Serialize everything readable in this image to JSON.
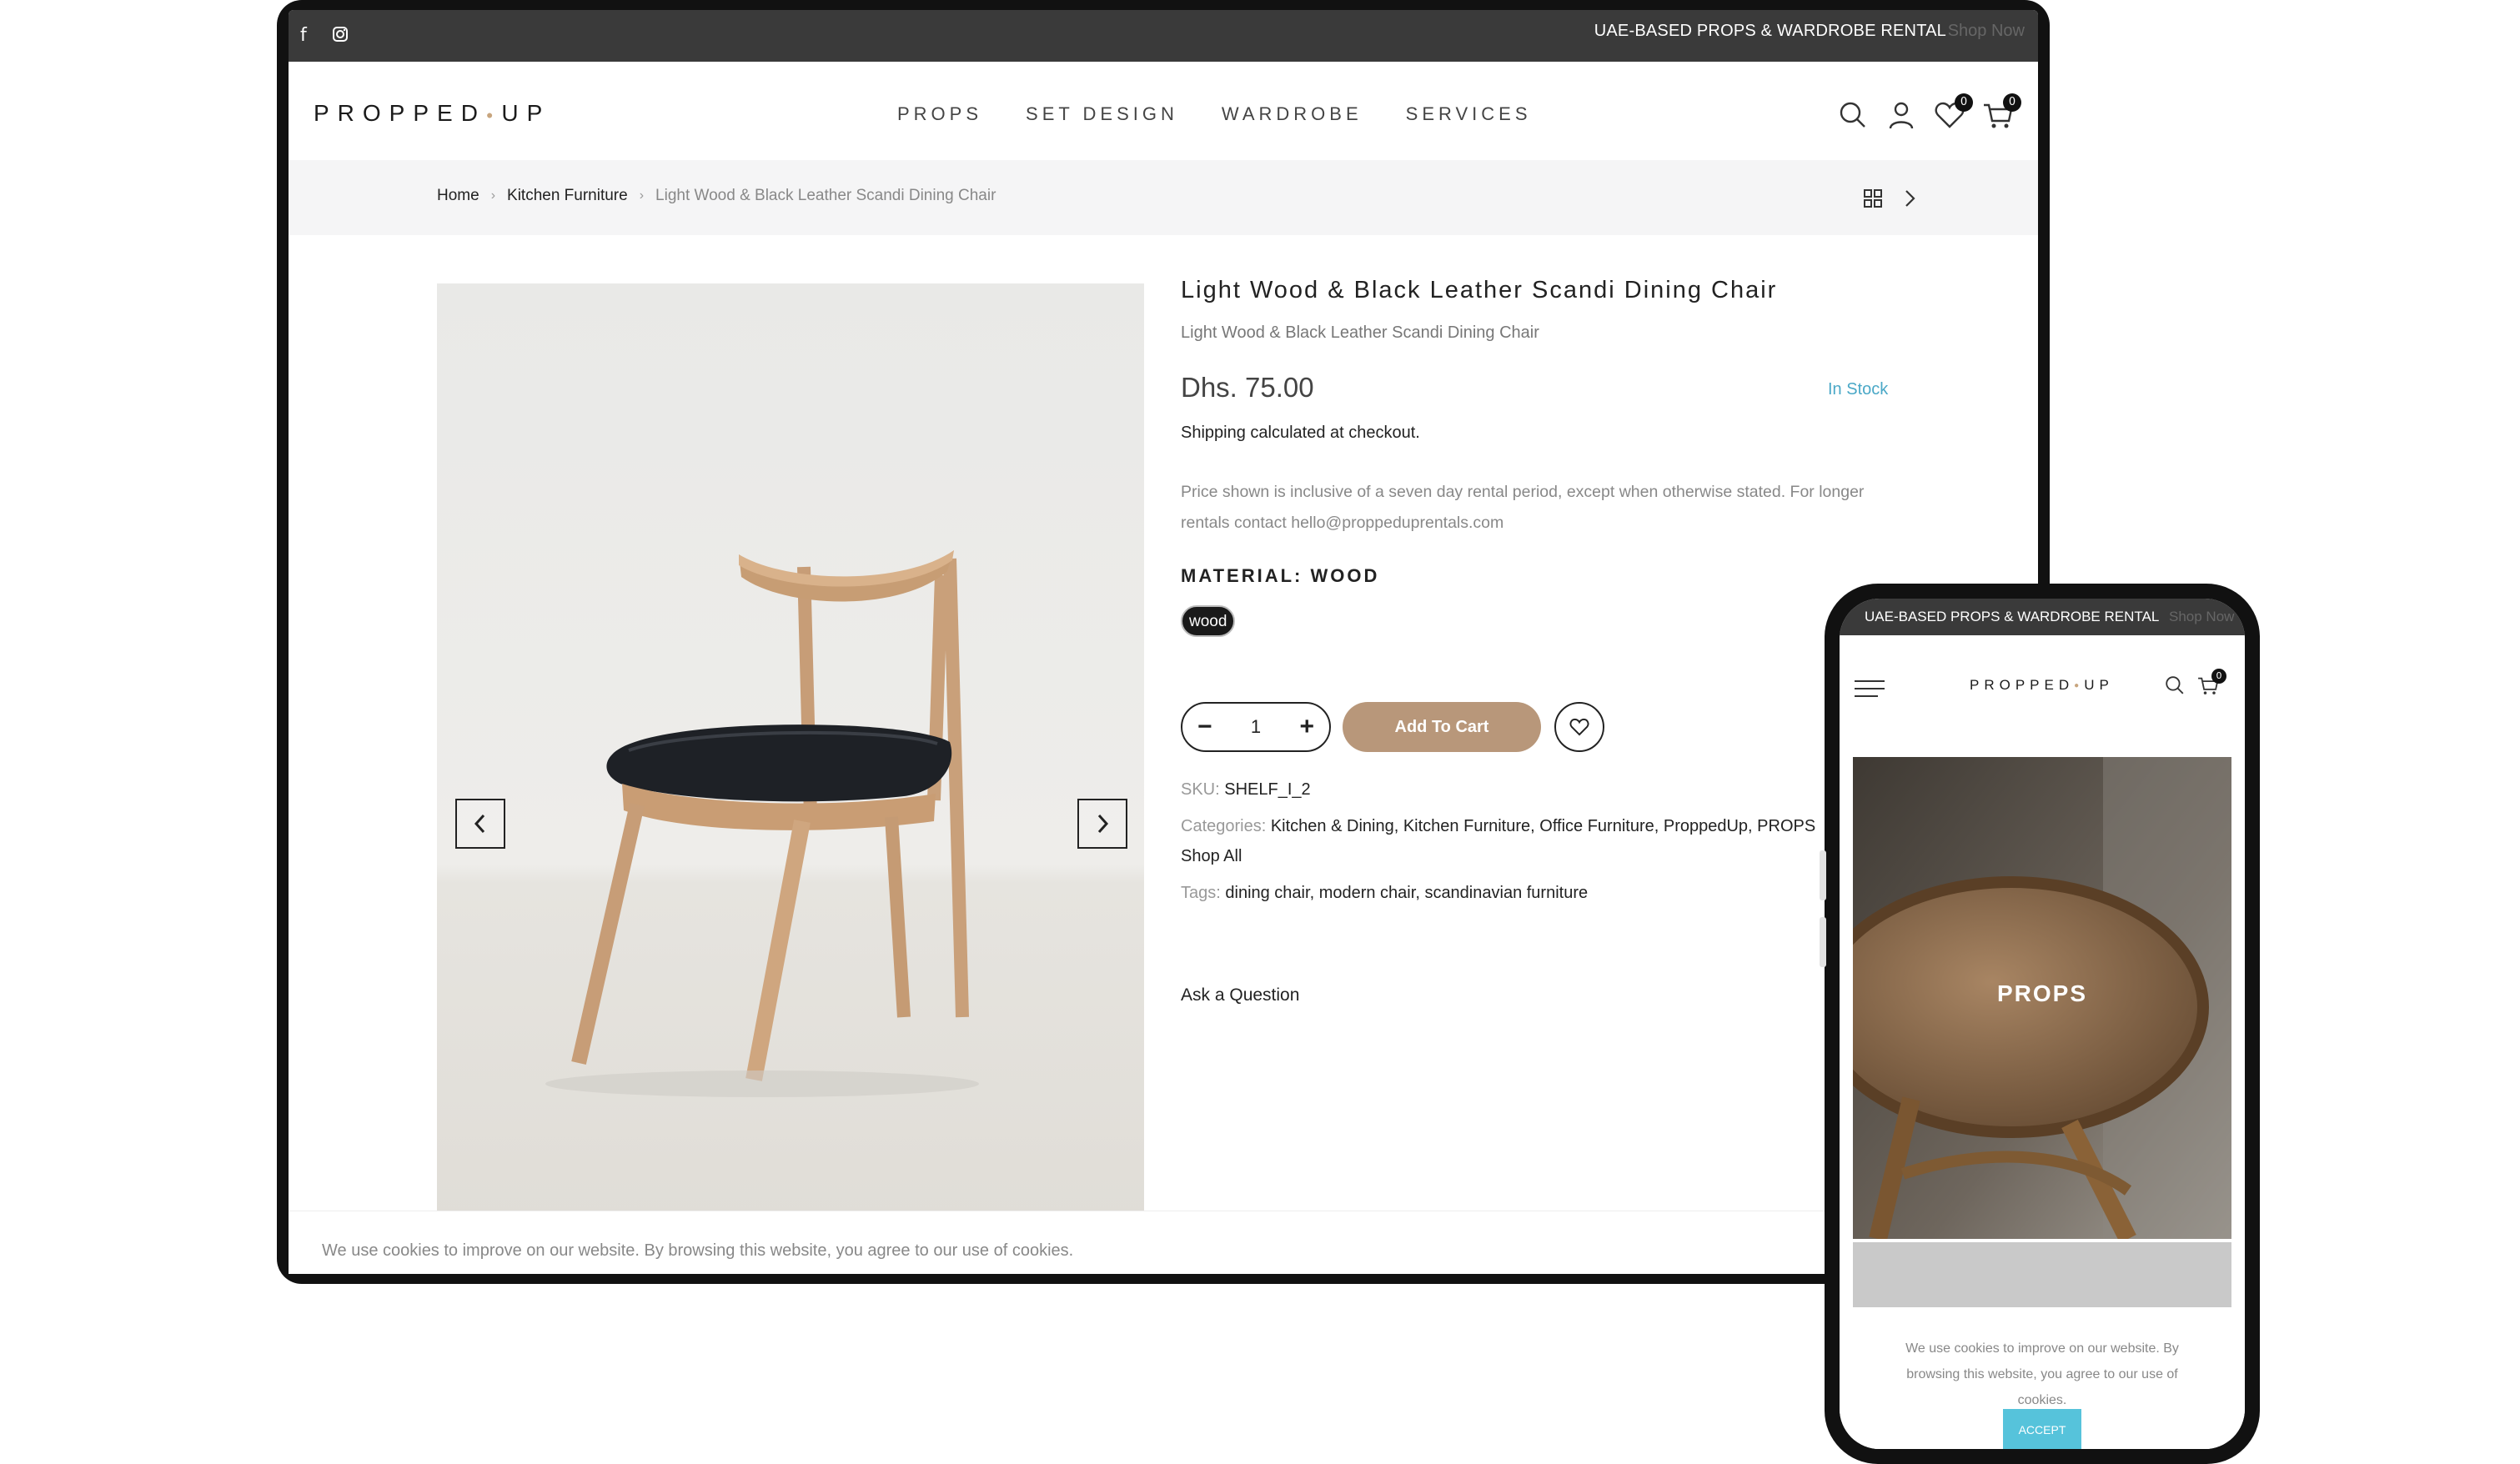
{
  "desktop": {
    "topbar": {
      "facebook_glyph": "f",
      "promo": "UAE-BASED PROPS & WARDROBE RENTAL",
      "shop_now": "Shop Now"
    },
    "header": {
      "logo_left": "PROPPED",
      "logo_right": "UP",
      "nav": [
        "PROPS",
        "SET DESIGN",
        "WARDROBE",
        "SERVICES"
      ],
      "wishlist_count": "0",
      "cart_count": "0"
    },
    "breadcrumb": {
      "home": "Home",
      "category": "Kitchen Furniture",
      "current": "Light Wood & Black Leather Scandi Dining Chair"
    },
    "product": {
      "title": "Light Wood & Black Leather Scandi Dining Chair",
      "subtitle": "Light Wood & Black Leather Scandi Dining Chair",
      "price": "Dhs. 75.00",
      "stock": "In Stock",
      "shipping": "Shipping calculated at checkout.",
      "note_line1": "Price shown is inclusive of a seven day rental period, except when otherwise stated. For longer",
      "note_line2": "rentals contact hello@proppeduprentals.com",
      "material_label": "MATERIAL: WOOD",
      "material_option": "wood",
      "quantity": "1",
      "add_to_cart": "Add To Cart",
      "sku_label": "SKU:",
      "sku_value": "SHELF_I_2",
      "categories_label": "Categories:",
      "categories": [
        "Kitchen & Dining",
        "Kitchen Furniture",
        "Office Furniture",
        "ProppedUp",
        "PROPS"
      ],
      "categories_line2": "Shop All",
      "tags_label": "Tags:",
      "tags": [
        "dining chair",
        "modern chair",
        "scandinavian furniture"
      ],
      "ask": "Ask a Question"
    },
    "cookie": "We use cookies to improve on our website. By browsing this website, you agree to our use of cookies."
  },
  "phone": {
    "promo": "UAE-BASED PROPS & WARDROBE RENTAL",
    "shop_now": "Shop Now",
    "logo_left": "PROPPED",
    "logo_right": "UP",
    "cart_count": "0",
    "hero_title": "PROPS",
    "cookie_line1": "We use cookies to improve on our website. By",
    "cookie_line2": "browsing this website, you agree to our use of",
    "cookie_line3": "cookies.",
    "accept": "ACCEPT"
  },
  "colors": {
    "accent_tan": "#b8977a",
    "stock_blue": "#4aa8c7",
    "accept_cyan": "#56c3db",
    "topbar": "#3a3a3a"
  },
  "icons": [
    "facebook-icon",
    "instagram-icon",
    "search-icon",
    "user-icon",
    "heart-icon",
    "cart-icon",
    "grid-icon",
    "chevron-right-icon",
    "arrow-left-icon",
    "arrow-right-icon",
    "minus-icon",
    "plus-icon",
    "hamburger-icon"
  ]
}
